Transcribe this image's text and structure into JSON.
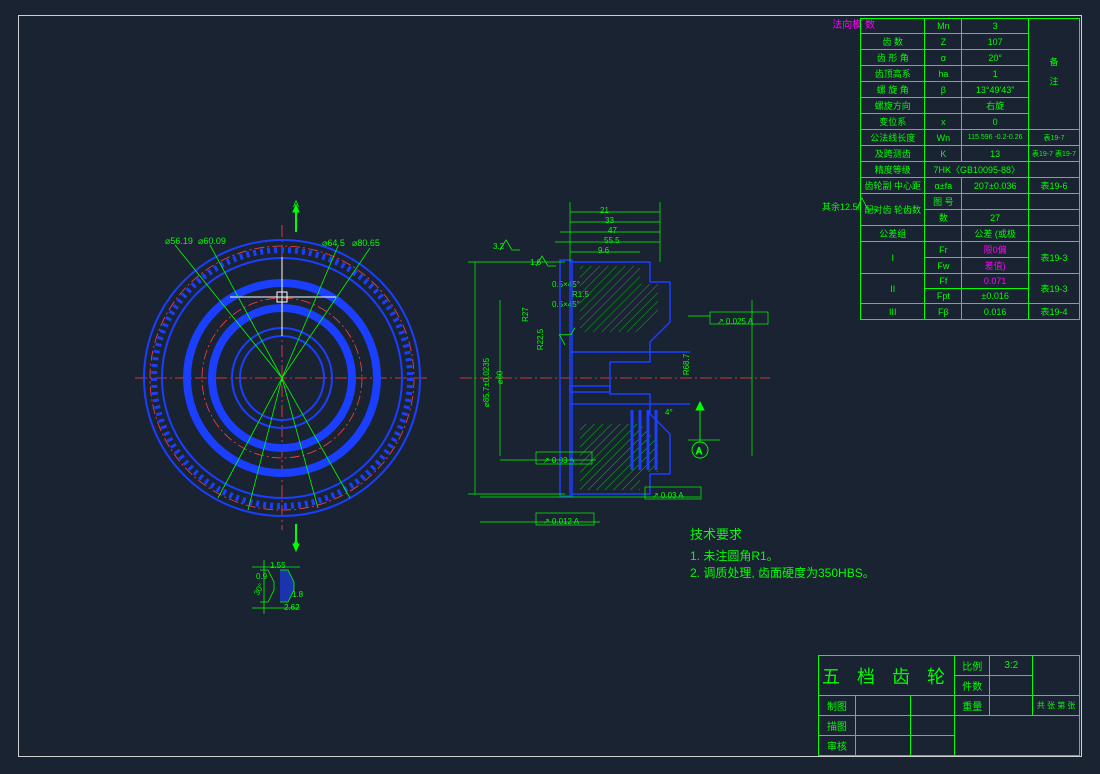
{
  "header_label": "法向模\n数",
  "rest_symbol": "其余12.5/",
  "section_marks": {
    "top": "A",
    "bottom": "A"
  },
  "gear_front_diameters": {
    "d1": "⌀56.19",
    "d2": "⌀60.09",
    "d3": "⌀64.5",
    "d4": "⌀80.65"
  },
  "cross_section": {
    "top_dims": {
      "w1": "21",
      "w2": "33",
      "w3": "47",
      "w4": "55.5",
      "w5": "9.6"
    },
    "left_dia": {
      "outer": "⌀85.7±0.0235",
      "mid": "⌀60"
    },
    "chamfers": {
      "c1": "0.5×45°",
      "c2": "0.5×45°",
      "r1": "R1.5",
      "r27": "R27",
      "r22_5": "R22.5",
      "c3": "1.6"
    },
    "right_dia": {
      "r1": "R68.7"
    },
    "angles": {
      "a1": "4°",
      "a2": "3.2"
    },
    "gtol": {
      "runout1": "↗ 0.03 A",
      "runout2": "↗ 0.025 A",
      "runout3": "↗ 0.03 A",
      "runout4": "↗ 0.012 A"
    },
    "surf": {
      "s1": "3.2",
      "s2": "1.6",
      "s3": "1.6"
    },
    "datum": "A",
    "extra": {
      "l32": "3.2",
      "l18": "1.8"
    }
  },
  "spline_detail": {
    "w1": "1.55",
    "h1": "0.9",
    "w2": "2.62",
    "h2": "1.8",
    "ang": "30°"
  },
  "tech_req": {
    "title": "技术要求",
    "line1": "1. 未注圆角R1。",
    "line2": "2. 调质处理, 齿面硬度为350HBS。"
  },
  "param_rows": [
    {
      "name": "",
      "sym": "Mn",
      "val": "3",
      "note": ""
    },
    {
      "name": "齿  数",
      "sym": "Z",
      "val": "107",
      "note": ""
    },
    {
      "name": "齿 形 角",
      "sym": "α",
      "val": "20°",
      "note": ""
    },
    {
      "name": "齿顶高系",
      "sym": "ha",
      "val": "1",
      "note": ""
    },
    {
      "name": "螺 旋 角",
      "sym": "β",
      "val": "13°49'43\"",
      "note": ""
    },
    {
      "name": "螺旋方向",
      "sym": "",
      "val": "右旋",
      "note": ""
    },
    {
      "name": "变位系",
      "sym": "x",
      "val": "0",
      "note": ""
    },
    {
      "name": "公法线长度",
      "sym": "Wn",
      "val": "115.596 -0.2-0.26",
      "note": "表19-7"
    },
    {
      "name": "及跨测齿",
      "sym": "K",
      "val": "13",
      "note": "表19-7 表19-7"
    },
    {
      "name": "精度等级",
      "sym2": "7HK〈GB10095-88〉",
      "note": ""
    },
    {
      "name": "齿轮副\n中心距",
      "sym": "α±fa",
      "val": "207±0.036",
      "note": "表19-6"
    },
    {
      "name": "配对齿\n轮齿数",
      "sym": "图\n号",
      "val": "",
      "note": ""
    },
    {
      "name": "",
      "sym": "数",
      "val": "27",
      "note": ""
    },
    {
      "name": "公差组",
      "sym": "",
      "val": "公差\n(或极",
      "note": ""
    },
    {
      "group": "I",
      "sym": "Fr",
      "val": "限0偏",
      "note": "表19-3"
    },
    {
      "group": "",
      "sym": "Fw",
      "val": "差值)",
      "note": ""
    },
    {
      "group": "II",
      "sym": "Ff",
      "val": "0.071",
      "note": "表19-3"
    },
    {
      "group": "",
      "sym": "Fpt",
      "val": "±0.016",
      "note": ""
    },
    {
      "group": "III",
      "sym": "Fβ",
      "val": "0.016",
      "note": "表19-4"
    }
  ],
  "notes_col_text": "备\n\n注",
  "title_block": {
    "main": "五 档 齿 轮",
    "scale_lbl": "比例",
    "scale": "3:2",
    "partno_lbl": "件数",
    "partno": "",
    "mass_lbl": "重量",
    "mass": "",
    "material_lbl": "共 张 第 张",
    "rows": [
      {
        "role": "制图",
        "name": "",
        "date": ""
      },
      {
        "role": "描图",
        "name": "",
        "date": ""
      },
      {
        "role": "审核",
        "name": "",
        "date": ""
      }
    ]
  }
}
